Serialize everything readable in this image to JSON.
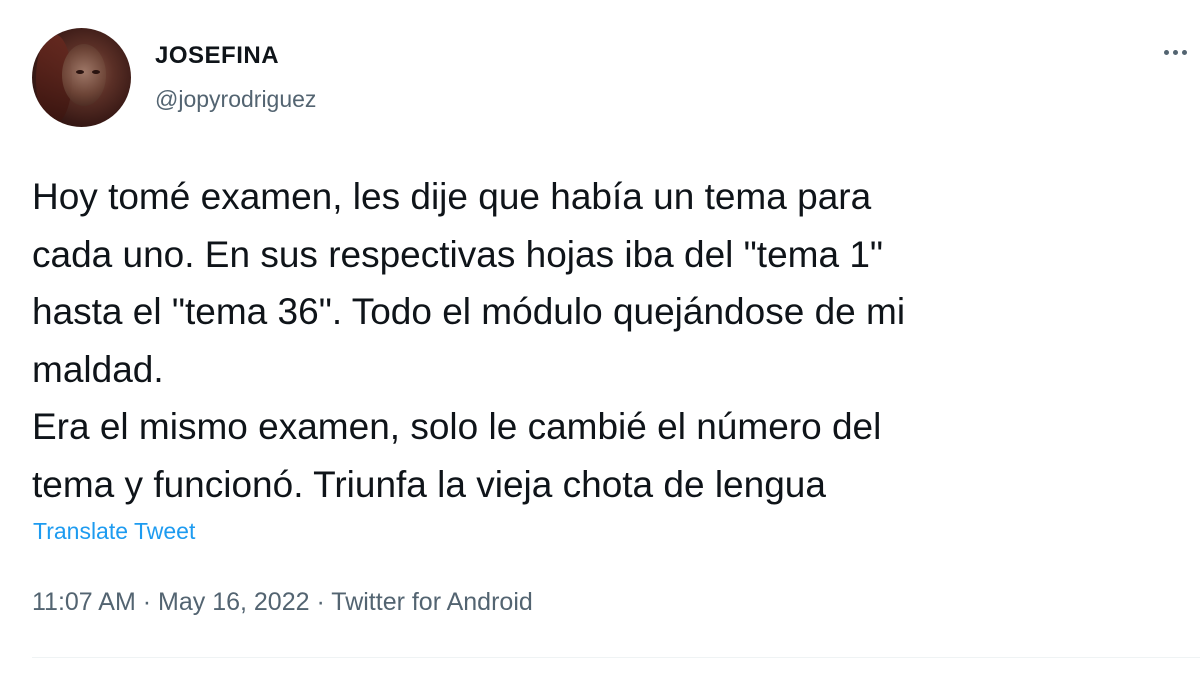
{
  "tweet": {
    "author": {
      "display_name": "JOSEFINA",
      "handle": "@jopyrodriguez",
      "avatar_icon": "profile-photo"
    },
    "text": "Hoy tomé examen, les dije que había un tema para\ncada uno. En sus respectivas hojas iba del \"tema 1\"\nhasta el \"tema 36\". Todo el módulo quejándose de mi\nmaldad.\nEra el mismo examen, solo le cambié el número del\ntema y funcionó. Triunfa la vieja chota de lengua",
    "translate_label": "Translate Tweet",
    "time": "11:07 AM",
    "separator": "·",
    "date": "May 16, 2022",
    "source": "Twitter for Android",
    "more_icon": "more-horizontal-icon"
  },
  "colors": {
    "text_primary": "#0f1419",
    "text_secondary": "#536471",
    "link": "#1d9bf0",
    "divider": "#eff3f4"
  }
}
